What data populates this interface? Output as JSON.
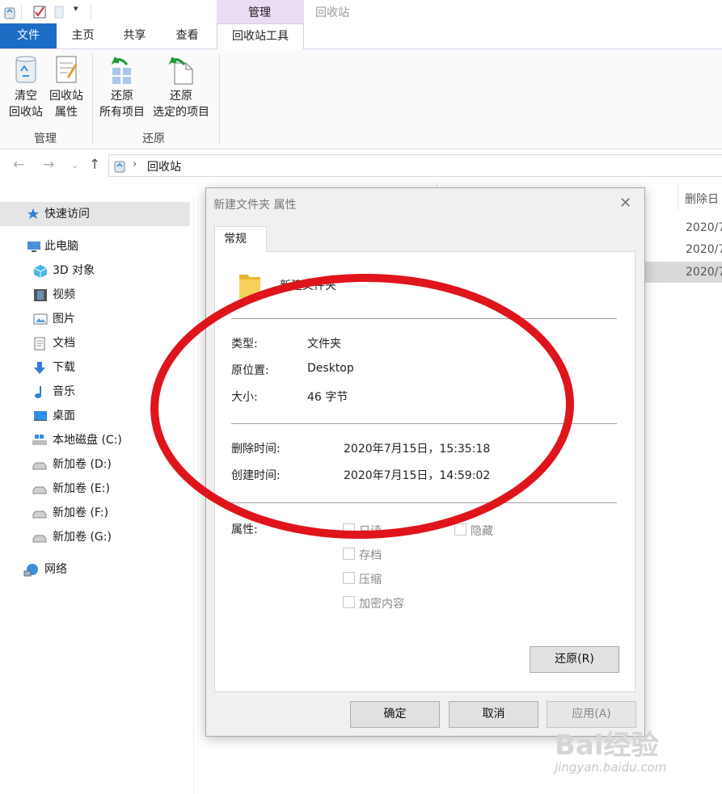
{
  "ribbon_tabs": {
    "file": "文件",
    "home": "主页",
    "share": "共享",
    "view": "查看",
    "context_group": "管理",
    "context_window": "回收站",
    "tools": "回收站工具"
  },
  "ribbon": {
    "empty_bin": [
      "清空",
      "回收站"
    ],
    "bin_properties": [
      "回收站",
      "属性"
    ],
    "restore_all": [
      "还原",
      "所有项目"
    ],
    "restore_selected": [
      "还原",
      "选定的项目"
    ],
    "group_manage": "管理",
    "group_restore": "还原"
  },
  "address": {
    "path": "回收站"
  },
  "nav": {
    "items": [
      {
        "label": "快速访问",
        "icon": "star-icon"
      },
      {
        "label": "此电脑",
        "icon": "computer-icon"
      },
      {
        "label": "3D 对象",
        "icon": "cube-icon"
      },
      {
        "label": "视频",
        "icon": "film-icon"
      },
      {
        "label": "图片",
        "icon": "picture-icon"
      },
      {
        "label": "文档",
        "icon": "document-icon"
      },
      {
        "label": "下载",
        "icon": "download-arrow-icon"
      },
      {
        "label": "音乐",
        "icon": "music-note-icon"
      },
      {
        "label": "桌面",
        "icon": "desktop-icon"
      },
      {
        "label": "本地磁盘 (C:)",
        "icon": "windows-drive-icon"
      },
      {
        "label": "新加卷 (D:)",
        "icon": "drive-icon"
      },
      {
        "label": "新加卷 (E:)",
        "icon": "drive-icon"
      },
      {
        "label": "新加卷 (F:)",
        "icon": "drive-icon"
      },
      {
        "label": "新加卷 (G:)",
        "icon": "drive-icon"
      },
      {
        "label": "网络",
        "icon": "network-icon"
      }
    ]
  },
  "list": {
    "col_deleted": "删除日",
    "rows": [
      "2020/7",
      "2020/7",
      "2020/7"
    ]
  },
  "dialog": {
    "title": "新建文件夹 属性",
    "tab": "常规",
    "name": "新建文件夹",
    "type_label": "类型:",
    "type_value": "文件夹",
    "origin_label": "原位置:",
    "origin_value": "Desktop",
    "size_label": "大小:",
    "size_value": "46 字节",
    "deleted_label": "删除时间:",
    "deleted_value": "2020年7月15日，15:35:18",
    "created_label": "创建时间:",
    "created_value": "2020年7月15日，14:59:02",
    "attr_label": "属性:",
    "attr_readonly": "只读",
    "attr_hidden": "隐藏",
    "attr_archive": "存档",
    "attr_compress": "压缩",
    "attr_encrypt": "加密内容",
    "restore_button": "还原(R)",
    "ok_button": "确定",
    "cancel_button": "取消",
    "apply_button": "应用(A)"
  },
  "watermark": {
    "logo": "Bai经验",
    "url": "jingyan.baidu.com"
  },
  "colors": {
    "file_tab": "#1b6dc4",
    "context_tab": "#eadcf2",
    "annotation": "#e0141b"
  }
}
